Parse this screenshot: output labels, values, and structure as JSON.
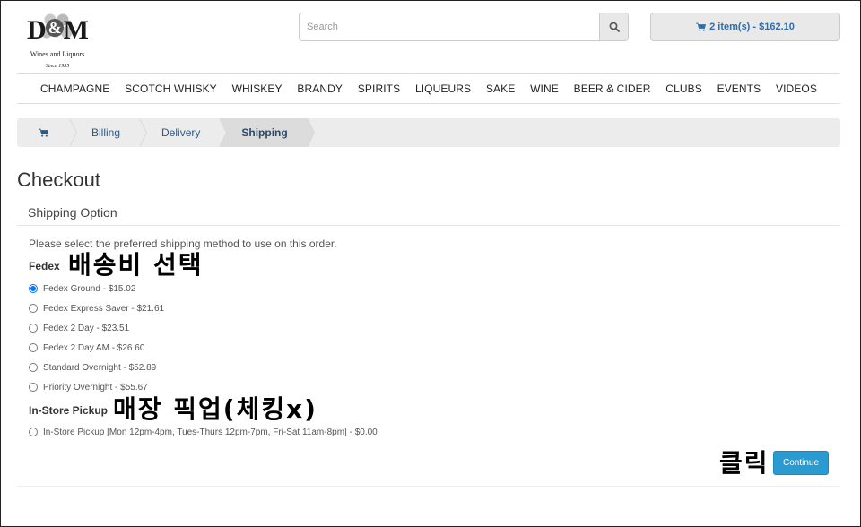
{
  "header": {
    "logo": {
      "letters_left": "D",
      "letters_amp": "&",
      "letters_right": "M",
      "line1": "Wines and Liquors",
      "line2": "Since 1935"
    },
    "search": {
      "placeholder": "Search"
    },
    "cart": {
      "label": "2 item(s) - $162.10"
    }
  },
  "nav": {
    "items": [
      {
        "label": "CHAMPAGNE"
      },
      {
        "label": "SCOTCH WHISKY"
      },
      {
        "label": "WHISKEY"
      },
      {
        "label": "BRANDY"
      },
      {
        "label": "SPIRITS"
      },
      {
        "label": "LIQUEURS"
      },
      {
        "label": "SAKE"
      },
      {
        "label": "WINE"
      },
      {
        "label": "BEER & CIDER"
      },
      {
        "label": "CLUBS"
      },
      {
        "label": "EVENTS"
      },
      {
        "label": "VIDEOS"
      }
    ]
  },
  "breadcrumb": {
    "steps": [
      {
        "label": "Billing"
      },
      {
        "label": "Delivery"
      },
      {
        "label": "Shipping"
      }
    ]
  },
  "page": {
    "title": "Checkout",
    "panel_title": "Shipping Option",
    "instructions": "Please select the preferred shipping method to use on this order."
  },
  "shipping": {
    "groups": [
      {
        "name": "Fedex",
        "annotation": "배송비 선택",
        "options": [
          {
            "label": "Fedex Ground - $15.02"
          },
          {
            "label": "Fedex Express Saver - $21.61"
          },
          {
            "label": "Fedex 2 Day - $23.51"
          },
          {
            "label": "Fedex 2 Day AM - $26.60"
          },
          {
            "label": "Standard Overnight - $52.89"
          },
          {
            "label": "Priority Overnight - $55.67"
          }
        ]
      },
      {
        "name": "In-Store Pickup",
        "annotation": "매장 픽업(체킹x)",
        "options": [
          {
            "label": "In-Store Pickup [Mon 12pm-4pm, Tues-Thurs 12pm-7pm, Fri-Sat 11am-8pm] - $0.00"
          }
        ]
      }
    ],
    "selected": "Fedex Ground - $15.02"
  },
  "actions": {
    "continue_label": "Continue",
    "continue_annotation": "클릭"
  },
  "colors": {
    "accent": "#2a9bd1",
    "link": "#2a6fb0"
  }
}
